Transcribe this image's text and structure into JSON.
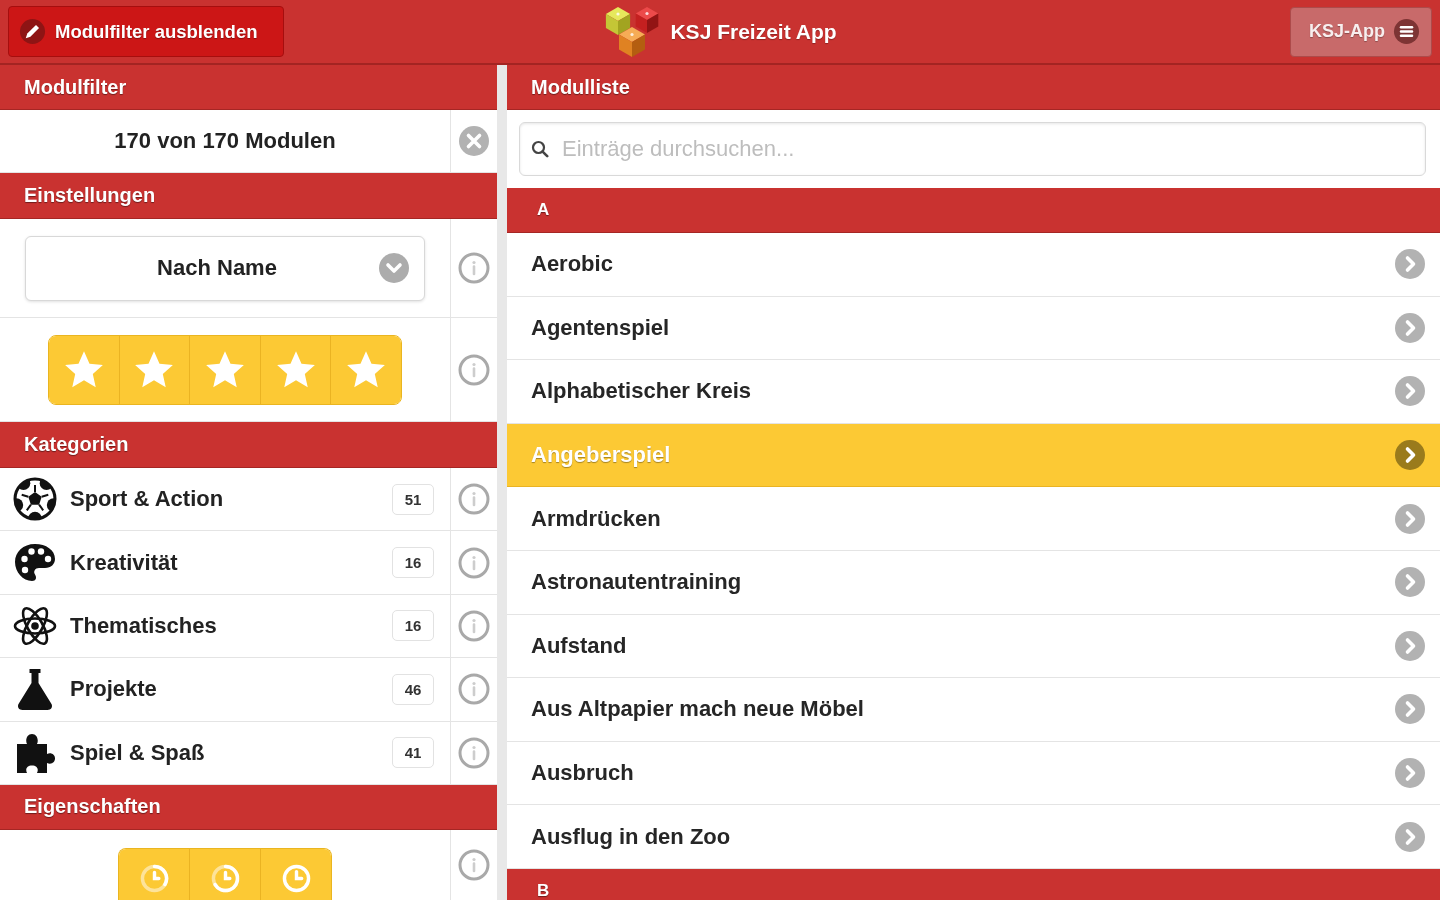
{
  "header": {
    "filter_button": "Modulfilter ausblenden",
    "title": "KSJ Freizeit App",
    "menu_button": "KSJ-App"
  },
  "filter_panel": {
    "title": "Modulfilter",
    "summary": "170 von 170 Modulen",
    "settings": {
      "title": "Einstellungen",
      "sort": {
        "value": "Nach Name"
      },
      "rating_filter": [
        {
          "selected": true
        },
        {
          "selected": true
        },
        {
          "selected": true
        },
        {
          "selected": true
        },
        {
          "selected": true
        }
      ]
    },
    "categories": {
      "title": "Kategorien",
      "items": [
        {
          "label": "Sport & Action",
          "count": "51"
        },
        {
          "label": "Kreativität",
          "count": "16"
        },
        {
          "label": "Thematisches",
          "count": "16"
        },
        {
          "label": "Projekte",
          "count": "46"
        },
        {
          "label": "Spiel & Spaß",
          "count": "41"
        }
      ]
    },
    "properties": {
      "title": "Eigenschaften",
      "durations": [
        {
          "selected": true
        },
        {
          "selected": true
        },
        {
          "selected": true
        }
      ]
    }
  },
  "module_list": {
    "title": "Modulliste",
    "search": {
      "placeholder": "Einträge durchsuchen..."
    },
    "sections": [
      {
        "letter": "A",
        "items": [
          {
            "label": "Aerobic",
            "selected": false
          },
          {
            "label": "Agentenspiel",
            "selected": false
          },
          {
            "label": "Alphabetischer Kreis",
            "selected": false
          },
          {
            "label": "Angeberspiel",
            "selected": true
          },
          {
            "label": "Armdrücken",
            "selected": false
          },
          {
            "label": "Astronautentraining",
            "selected": false
          },
          {
            "label": "Aufstand",
            "selected": false
          },
          {
            "label": "Aus Altpapier mach neue Möbel",
            "selected": false
          },
          {
            "label": "Ausbruch",
            "selected": false
          },
          {
            "label": "Ausflug in den Zoo",
            "selected": false
          }
        ]
      },
      {
        "letter": "B"
      }
    ]
  }
}
